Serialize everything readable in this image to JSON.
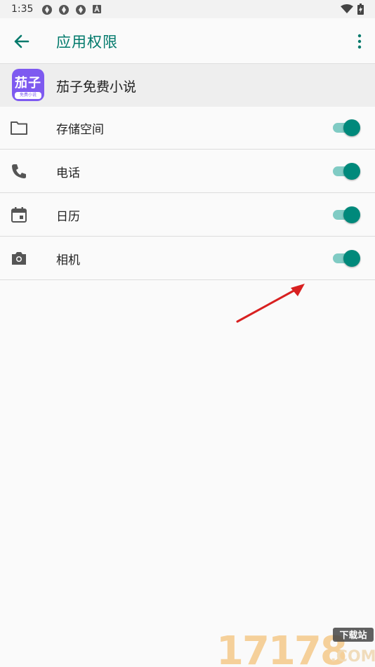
{
  "status_bar": {
    "time": "1:35",
    "left_icons": [
      "notification-icon",
      "notification-icon",
      "notification-icon",
      "keyboard-a-icon"
    ],
    "right_icons": [
      "wifi-icon",
      "battery-charging-icon"
    ]
  },
  "app_bar": {
    "title": "应用权限",
    "back_icon": "arrow-back-icon",
    "menu_icon": "more-vert-icon",
    "accent_color": "#00796b"
  },
  "app": {
    "name": "茄子免费小说",
    "icon_text": "茄子",
    "icon_subtext": "免费小说",
    "icon_color": "#7e5af0"
  },
  "permissions": [
    {
      "label": "存储空间",
      "icon": "folder-icon",
      "enabled": true
    },
    {
      "label": "电话",
      "icon": "phone-icon",
      "enabled": true
    },
    {
      "label": "日历",
      "icon": "calendar-icon",
      "enabled": true
    },
    {
      "label": "相机",
      "icon": "camera-icon",
      "enabled": true
    }
  ],
  "toggle_colors": {
    "thumb": "#00897b",
    "track": "#80cbc4"
  },
  "watermark": {
    "number": "17178",
    "top": "下载站",
    "bottom": ".COM"
  }
}
